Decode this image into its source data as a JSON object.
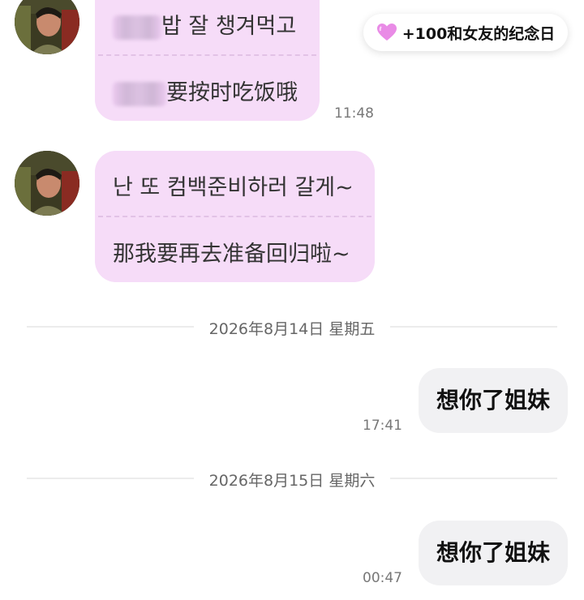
{
  "messages_incoming": [
    {
      "lines": [
        "밥 잘 챙겨먹고",
        "要按时吃饭哦"
      ],
      "time": "11:48"
    },
    {
      "lines": [
        "난 또 컴백준비하러 갈게~",
        "那我要再去准备回归啦~"
      ],
      "time": ""
    }
  ],
  "date_separators": [
    {
      "text": "2026年8月14日 星期五"
    },
    {
      "text": "2026年8月15日 星期六"
    }
  ],
  "messages_outgoing": [
    {
      "text": "想你了姐妹",
      "time": "17:41"
    },
    {
      "text": "想你了姐妹",
      "time": "00:47"
    }
  ],
  "anniversary_badge": {
    "icon": "heart-icon",
    "text": "+100和女友的纪念日"
  },
  "colors": {
    "incoming_bubble": "#f6dcf8",
    "outgoing_bubble": "#f1f1f3",
    "heart": "#e98be6"
  }
}
